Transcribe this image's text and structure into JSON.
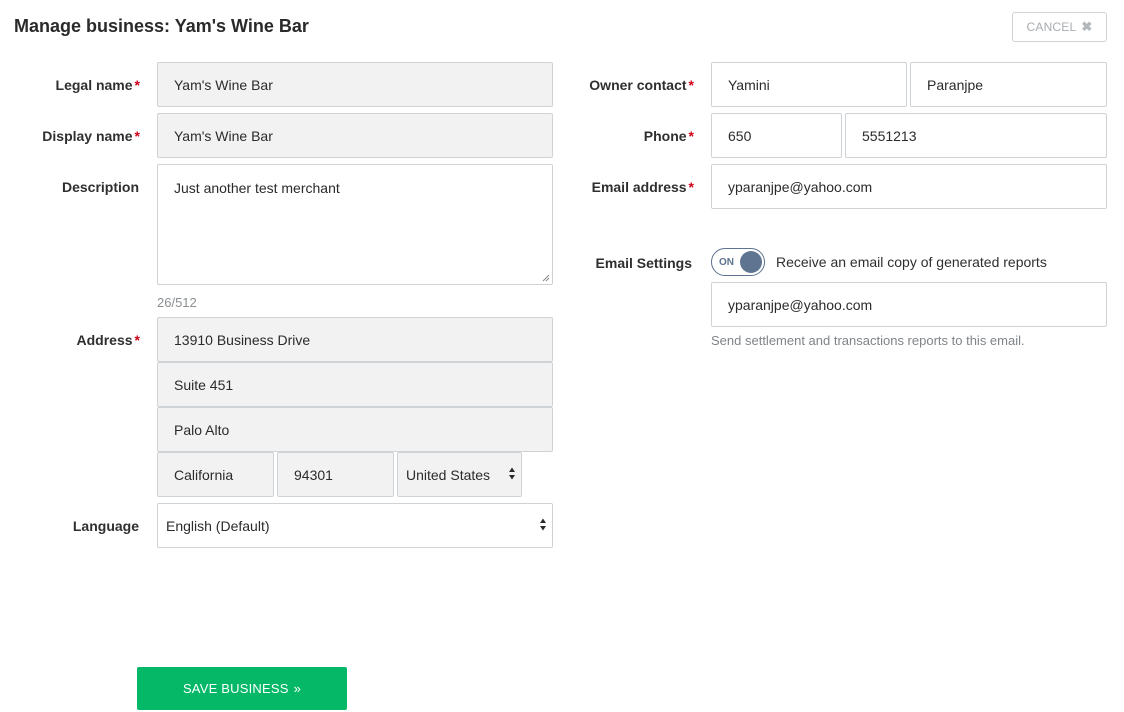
{
  "header": {
    "title": "Manage business: Yam's Wine Bar",
    "cancel_label": "CANCEL",
    "cancel_icon": "close-icon"
  },
  "form": {
    "legal_name": {
      "label": "Legal name",
      "value": "Yam's Wine Bar",
      "required": "*"
    },
    "display_name": {
      "label": "Display name",
      "value": "Yam's Wine Bar",
      "required": "*"
    },
    "description": {
      "label": "Description",
      "value": "Just another test merchant",
      "counter": "26/512"
    },
    "address": {
      "label": "Address",
      "required": "*",
      "line1": "13910 Business Drive",
      "line2": "Suite 451",
      "city": "Palo Alto",
      "state": "California",
      "zip": "94301",
      "country": "United States"
    },
    "language": {
      "label": "Language",
      "value": "English (Default)"
    },
    "owner_contact": {
      "label": "Owner contact",
      "required": "*",
      "first_name": "Yamini",
      "last_name": "Paranjpe"
    },
    "phone": {
      "label": "Phone",
      "required": "*",
      "area_code": "650",
      "number": "5551213"
    },
    "email": {
      "label": "Email address",
      "required": "*",
      "value": "yparanjpe@yahoo.com"
    },
    "email_settings": {
      "label": "Email Settings",
      "toggle_state": "ON",
      "toggle_label": "Receive an email copy of generated reports",
      "report_email": "yparanjpe@yahoo.com",
      "help_text": "Send settlement and transactions reports to this email."
    }
  },
  "footer": {
    "save_label": "SAVE BUSINESS",
    "save_icon": "double-chevron-right-icon"
  },
  "colors": {
    "accent_green": "#04b867",
    "required_red": "#d0021b",
    "toggle_blue": "#5f7491"
  }
}
